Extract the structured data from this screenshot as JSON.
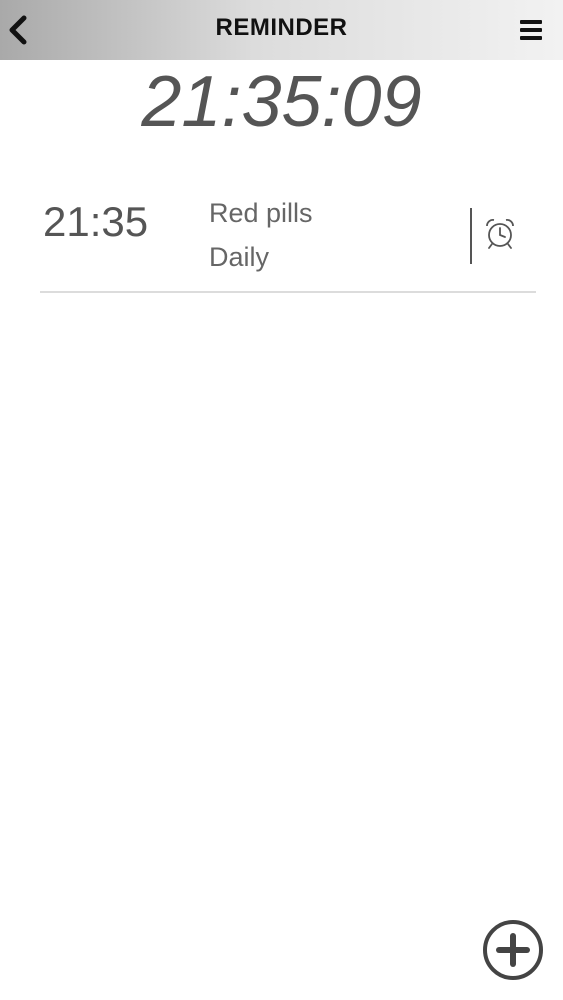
{
  "header": {
    "title": "REMINDER",
    "back_icon": "chevron-left-icon",
    "menu_icon": "hamburger-menu-icon"
  },
  "clock": {
    "current_time": "21:35:09"
  },
  "reminders": [
    {
      "time": "21:35",
      "name": "Red pills",
      "repeat": "Daily",
      "icon": "alarm-clock-icon"
    }
  ],
  "footer": {
    "add_icon": "plus-circle-icon"
  },
  "colors": {
    "text_dark": "#111111",
    "text_grey": "#555555",
    "divider": "#dcdcdc"
  }
}
